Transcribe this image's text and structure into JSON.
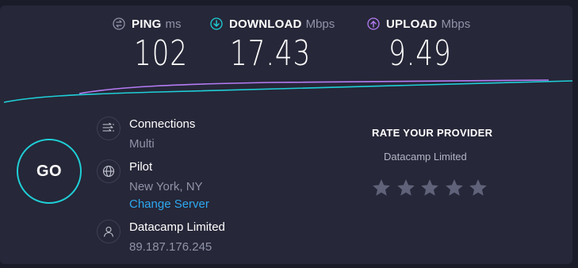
{
  "metrics": {
    "ping": {
      "label": "PING",
      "unit": "ms",
      "value": "102",
      "icon": "ping-icon"
    },
    "download": {
      "label": "DOWNLOAD",
      "unit": "Mbps",
      "value": "17.43",
      "icon": "download-arrow-icon"
    },
    "upload": {
      "label": "UPLOAD",
      "unit": "Mbps",
      "value": "9.49",
      "icon": "upload-arrow-icon"
    }
  },
  "go_button": {
    "label": "GO"
  },
  "connections": {
    "title": "Connections",
    "value": "Multi",
    "icon": "connections-icon"
  },
  "server": {
    "title": "Pilot",
    "location": "New York, NY",
    "change_link": "Change Server",
    "icon": "globe-icon"
  },
  "provider": {
    "title": "Datacamp Limited",
    "ip": "89.187.176.245",
    "icon": "user-icon"
  },
  "rating": {
    "title": "RATE YOUR PROVIDER",
    "isp": "Datacamp Limited",
    "star_count": 5,
    "selected": 0
  },
  "colors": {
    "background": "#1b1c2a",
    "panel": "#262738",
    "accent_cyan": "#1fcfd7",
    "accent_purple": "#b57cf5",
    "link": "#2da8f0",
    "muted": "#9193a8",
    "star": "#60627a"
  }
}
